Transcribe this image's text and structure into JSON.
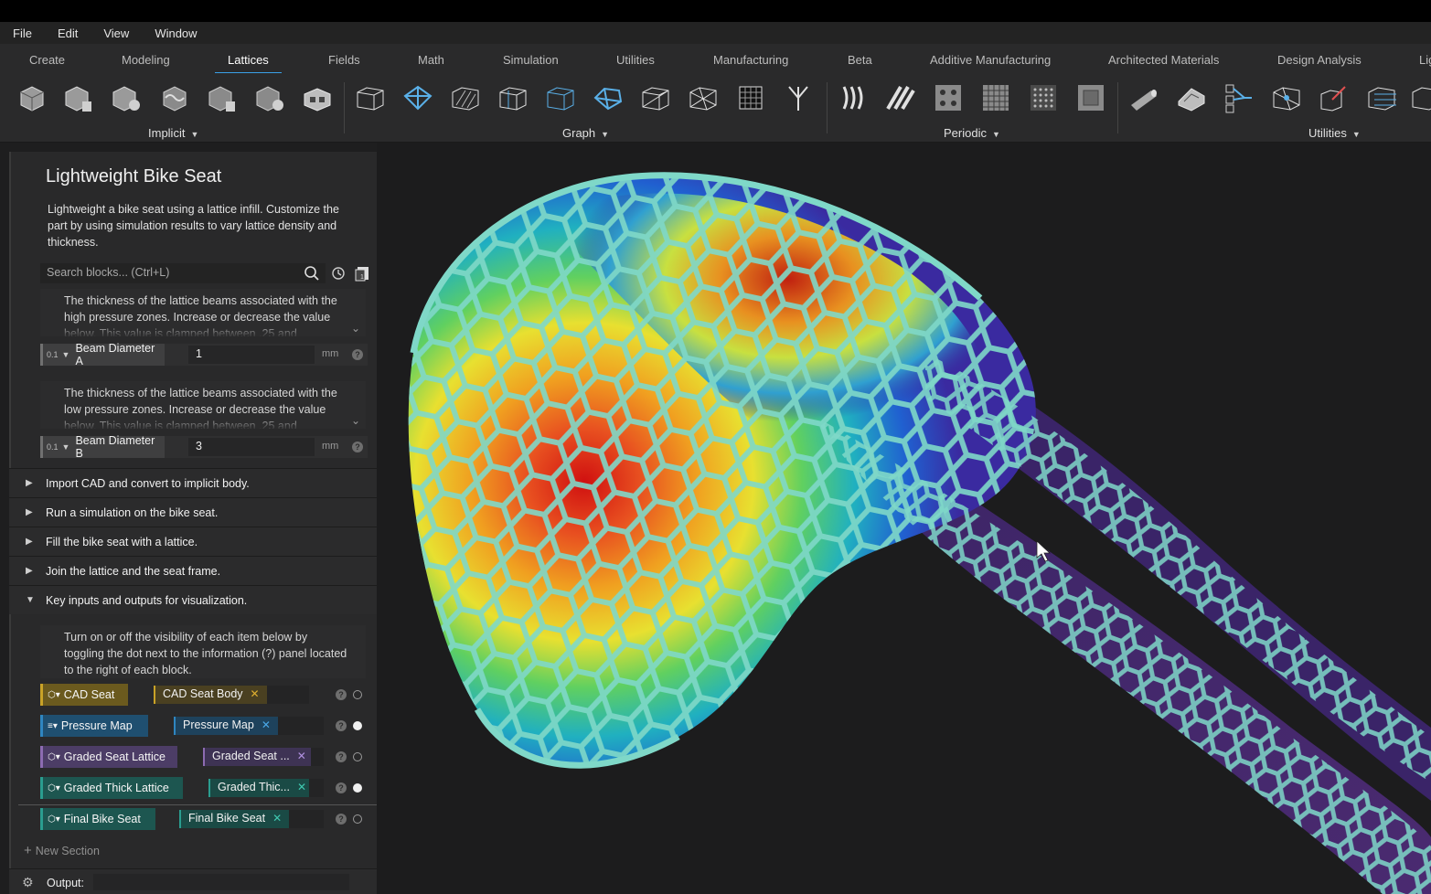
{
  "menu": [
    "File",
    "Edit",
    "View",
    "Window"
  ],
  "tabs": [
    "Create",
    "Modeling",
    "Lattices",
    "Fields",
    "Math",
    "Simulation",
    "Utilities",
    "Manufacturing",
    "Beta",
    "Additive Manufacturing",
    "Architected Materials",
    "Design Analysis",
    "Lig"
  ],
  "active_tab": "Lattices",
  "ribbon_groups": {
    "implicit": "Implicit",
    "graph": "Graph",
    "periodic": "Periodic",
    "utilities": "Utilities"
  },
  "panel": {
    "title": "Lightweight Bike Seat",
    "description": "Lightweight a bike seat using a lattice infill. Customize the part by using simulation results to vary lattice density and thickness.",
    "search_placeholder": "Search blocks... (Ctrl+L)",
    "help_a": "The thickness of the lattice beams associated with the high pressure zones. Increase or decrease the value below. This value is clamped between .25 and",
    "help_b": "The thickness of the lattice beams associated with the low pressure zones. Increase or decrease the value below. This value is clamped between .25 and",
    "input_a": {
      "badge": "0.1",
      "label": "Beam Diameter A",
      "value": "1",
      "unit": "mm"
    },
    "input_b": {
      "badge": "0.1",
      "label": "Beam Diameter B",
      "value": "3",
      "unit": "mm"
    },
    "sections": [
      "Import CAD and convert to implicit body.",
      "Run a simulation on the bike seat.",
      "Fill the bike seat with a lattice.",
      "Join the lattice and the seat frame.",
      "Key inputs and outputs for visualization."
    ],
    "vis_help": "Turn on or off the visibility of each item below by toggling the dot next to the information (?) panel located to the right of each block.",
    "vis_rows": [
      {
        "label": "CAD Seat",
        "tag": "CAD Seat Body",
        "color": "#c9a227",
        "visible": false
      },
      {
        "label": "Pressure Map",
        "tag": "Pressure Map",
        "color": "#2f86c0",
        "visible": true
      },
      {
        "label": "Graded Seat Lattice",
        "tag": "Graded Seat ...",
        "color": "#8c6bb1",
        "visible": false
      },
      {
        "label": "Graded Thick Lattice",
        "tag": "Graded Thic...",
        "color": "#2a9d8f",
        "visible": true
      },
      {
        "label": "Final Bike Seat",
        "tag": "Final Bike Seat",
        "color": "#2a9d8f",
        "visible": false
      }
    ],
    "new_section": "New Section",
    "output_label": "Output:"
  }
}
